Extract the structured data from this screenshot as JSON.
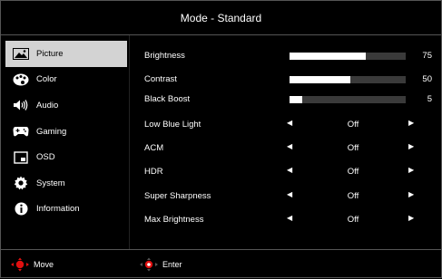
{
  "title": "Mode - Standard",
  "sidebar": {
    "items": [
      {
        "label": "Picture",
        "icon": "picture-icon",
        "active": true
      },
      {
        "label": "Color",
        "icon": "palette-icon",
        "active": false
      },
      {
        "label": "Audio",
        "icon": "speaker-icon",
        "active": false
      },
      {
        "label": "Gaming",
        "icon": "gamepad-icon",
        "active": false
      },
      {
        "label": "OSD",
        "icon": "osd-icon",
        "active": false
      },
      {
        "label": "System",
        "icon": "gear-icon",
        "active": false
      },
      {
        "label": "Information",
        "icon": "info-icon",
        "active": false
      }
    ]
  },
  "settings": {
    "brightness": {
      "label": "Brightness",
      "value": "75",
      "level": 0.66
    },
    "contrast": {
      "label": "Contrast",
      "value": "50",
      "level": 0.52
    },
    "black_boost": {
      "label": "Black Boost",
      "value": "5",
      "level": 0.11
    },
    "low_blue_light": {
      "label": "Low Blue Light",
      "value": "Off"
    },
    "acm": {
      "label": "ACM",
      "value": "Off"
    },
    "hdr": {
      "label": "HDR",
      "value": "Off"
    },
    "super_sharpness": {
      "label": "Super Sharpness",
      "value": "Off"
    },
    "max_brightness": {
      "label": "Max Brightness",
      "value": "Off"
    }
  },
  "footer": {
    "move_label": "Move",
    "enter_label": "Enter"
  },
  "colors": {
    "accent": "#e01010",
    "active_bg": "#d3d3d3",
    "bar_track": "#3a3a3a"
  }
}
